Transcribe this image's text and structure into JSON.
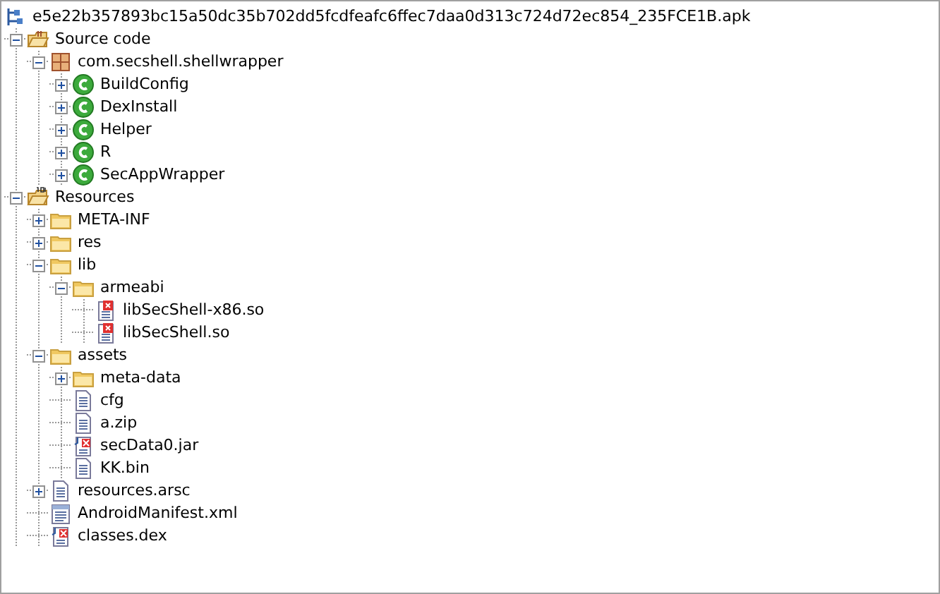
{
  "tree": {
    "label": "e5e22b357893bc15a50dc35b702dd5fcdfeafc6ffec7daa0d313c724d72ec854_235FCE1B.apk",
    "kind": "apk",
    "children": [
      {
        "label": "Source code",
        "kind": "source",
        "expanded": true,
        "children": [
          {
            "label": "com.secshell.shellwrapper",
            "kind": "package",
            "expanded": true,
            "children": [
              {
                "label": "BuildConfig",
                "kind": "class",
                "expanded": false
              },
              {
                "label": "DexInstall",
                "kind": "class",
                "expanded": false
              },
              {
                "label": "Helper",
                "kind": "class",
                "expanded": false
              },
              {
                "label": "R",
                "kind": "class",
                "expanded": false
              },
              {
                "label": "SecAppWrapper",
                "kind": "class",
                "expanded": false
              }
            ]
          }
        ]
      },
      {
        "label": "Resources",
        "kind": "resources",
        "expanded": true,
        "children": [
          {
            "label": "META-INF",
            "kind": "folder",
            "expanded": false
          },
          {
            "label": "res",
            "kind": "folder",
            "expanded": false
          },
          {
            "label": "lib",
            "kind": "folder",
            "expanded": true,
            "children": [
              {
                "label": "armeabi",
                "kind": "folder",
                "expanded": true,
                "children": [
                  {
                    "label": "libSecShell-x86.so",
                    "kind": "so"
                  },
                  {
                    "label": "libSecShell.so",
                    "kind": "so"
                  }
                ]
              }
            ]
          },
          {
            "label": "assets",
            "kind": "folder",
            "expanded": true,
            "children": [
              {
                "label": "meta-data",
                "kind": "folder",
                "expanded": false
              },
              {
                "label": "cfg",
                "kind": "file"
              },
              {
                "label": "a.zip",
                "kind": "file"
              },
              {
                "label": "secData0.jar",
                "kind": "jar"
              },
              {
                "label": "KK.bin",
                "kind": "file"
              }
            ]
          },
          {
            "label": "resources.arsc",
            "kind": "file",
            "expanded": false
          },
          {
            "label": "AndroidManifest.xml",
            "kind": "xml"
          },
          {
            "label": "classes.dex",
            "kind": "jar"
          }
        ]
      }
    ]
  }
}
